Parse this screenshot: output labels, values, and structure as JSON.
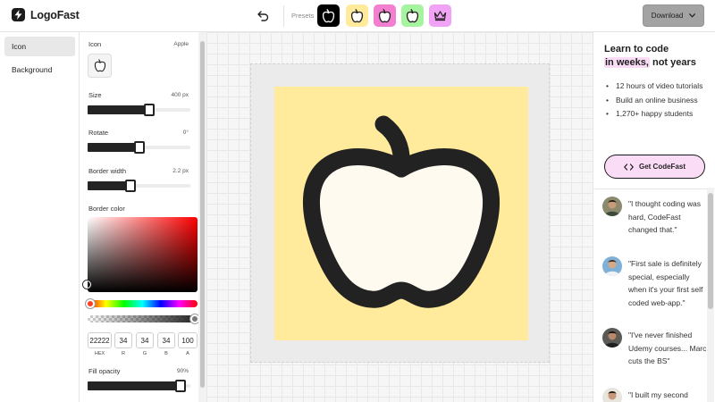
{
  "app": {
    "name": "LogoFast"
  },
  "toolbar": {
    "presets_label": "Presets",
    "presets": [
      {
        "bg": "#000000",
        "fg": "#ffffff",
        "icon": "apple-icon"
      },
      {
        "bg": "#ffeb9b",
        "fg": "#1f1f1f",
        "icon": "apple-icon"
      },
      {
        "bg": "#f27fd0",
        "fg": "#1f1f1f",
        "icon": "apple-icon"
      },
      {
        "bg": "#a6f3a0",
        "fg": "#1f1f1f",
        "icon": "apple-icon"
      },
      {
        "bg": "#f0a2f4",
        "fg": "#1f1f1f",
        "icon": "crown-icon"
      }
    ],
    "download_label": "Download"
  },
  "sidebar": {
    "items": [
      {
        "label": "Icon",
        "active": true
      },
      {
        "label": "Background",
        "active": false
      }
    ]
  },
  "settings": {
    "icon_label": "Icon",
    "icon_value": "Apple",
    "size": {
      "label": "Size",
      "value": "400 px",
      "level": 0.6
    },
    "rotate": {
      "label": "Rotate",
      "value": "0°",
      "level": 0.5
    },
    "border_width": {
      "label": "Border width",
      "value": "2.2 px",
      "level": 0.42
    },
    "border_color": {
      "label": "Border color",
      "hex": "222222",
      "hex_display": "22222",
      "r": "34",
      "g": "34",
      "b": "34",
      "a": "100",
      "caps": {
        "hex": "HEX",
        "r": "R",
        "g": "G",
        "b": "B",
        "a": "A"
      }
    },
    "fill_opacity": {
      "label": "Fill opacity",
      "value": "90%",
      "level": 0.9
    }
  },
  "canvas": {
    "background": "#ffeb9b",
    "icon": "apple-icon",
    "stroke": "#222222",
    "fill": "#fffaf0"
  },
  "promo": {
    "headline_1": "Learn to code",
    "headline_hl": "in weeks,",
    "headline_2": " not years",
    "bullets": [
      "12 hours of video tutorials",
      "Build an online business",
      "1,270+ happy students"
    ],
    "cta_label": "Get CodeFast",
    "testimonials": [
      {
        "quote": "\"I thought coding was hard, CodeFast changed that.\""
      },
      {
        "quote": "\"First sale is definitely special, especially when it's your first self coded web-app.\""
      },
      {
        "quote": "\"I've never finished Udemy courses... Marc cuts the BS\""
      },
      {
        "quote": "\"I built my second"
      }
    ]
  },
  "colors": {
    "accent_pink": "#fadcf7",
    "dark": "#222222",
    "download_bg": "#a3a3a3"
  }
}
